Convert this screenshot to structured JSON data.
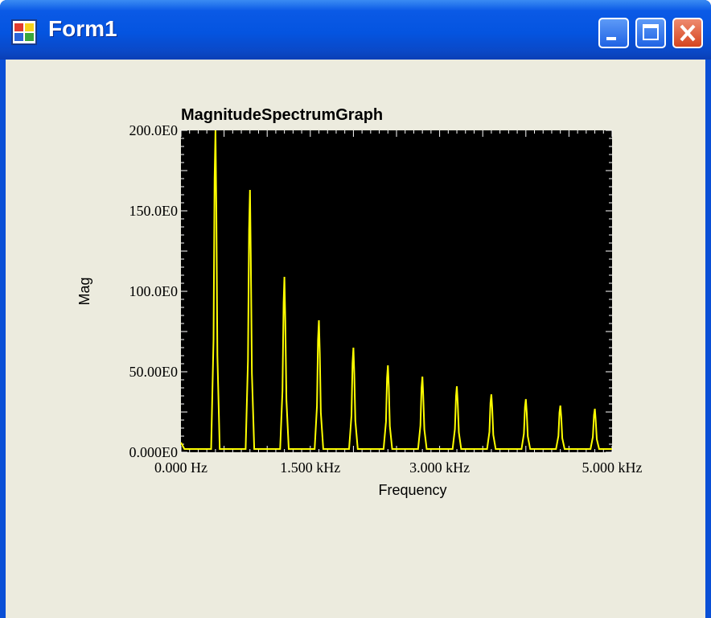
{
  "window": {
    "title": "Form1",
    "icon": "form-window-icon",
    "controls": [
      "minimize-icon",
      "maximize-icon",
      "close-icon"
    ]
  },
  "colors": {
    "plot_background": "#000000",
    "trace": "#ffff00",
    "form_background": "#ecebde"
  },
  "chart_data": {
    "type": "line",
    "title": "MagnitudeSpectrumGraph",
    "xlabel": "Frequency",
    "ylabel": "Mag",
    "xlim": [
      0,
      5000
    ],
    "ylim": [
      0,
      200
    ],
    "x_ticks": [
      {
        "value": 0,
        "label": "0.000 Hz"
      },
      {
        "value": 1500,
        "label": "1.500 kHz"
      },
      {
        "value": 3000,
        "label": "3.000 kHz"
      },
      {
        "value": 5000,
        "label": "5.000 kHz"
      }
    ],
    "y_ticks": [
      {
        "value": 0,
        "label": "0.000E0"
      },
      {
        "value": 50,
        "label": "50.00E0"
      },
      {
        "value": 100,
        "label": "100.0E0"
      },
      {
        "value": 150,
        "label": "150.0E0"
      },
      {
        "value": 200,
        "label": "200.0E0"
      }
    ],
    "grid": false,
    "series": [
      {
        "peaks": [
          {
            "x": 400,
            "y": 200
          },
          {
            "x": 800,
            "y": 163
          },
          {
            "x": 1200,
            "y": 109
          },
          {
            "x": 1600,
            "y": 82
          },
          {
            "x": 2000,
            "y": 65
          },
          {
            "x": 2400,
            "y": 54
          },
          {
            "x": 2800,
            "y": 47
          },
          {
            "x": 3200,
            "y": 41
          },
          {
            "x": 3600,
            "y": 36
          },
          {
            "x": 4000,
            "y": 33
          },
          {
            "x": 4400,
            "y": 29
          },
          {
            "x": 4800,
            "y": 27
          }
        ],
        "baseline": 2
      }
    ]
  }
}
